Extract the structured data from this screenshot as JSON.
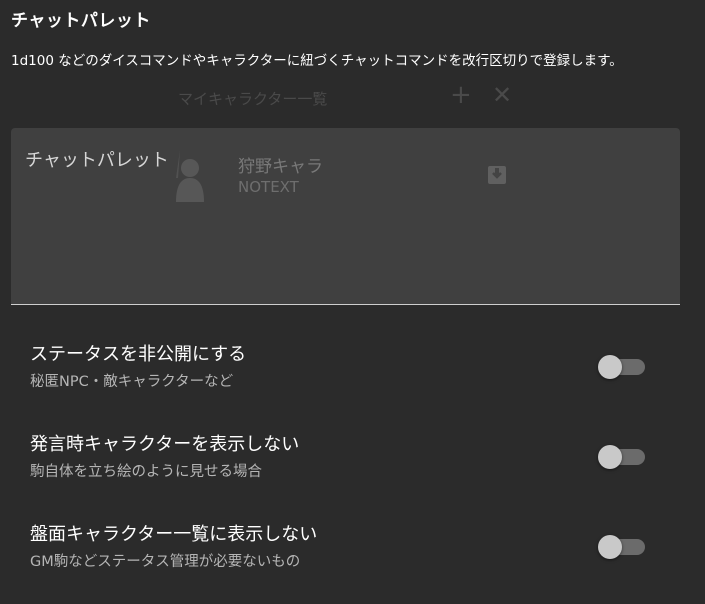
{
  "section": {
    "title": "チャットパレット",
    "description": "1d100 などのダイスコマンドやキャラクターに紐づくチャットコマンドを改行区切りで登録します。"
  },
  "background_window": {
    "title": "マイキャラクター一覧",
    "character_name": "狩野キャラ",
    "character_subtext": "NOTEXT",
    "plus_icon": "plus-icon",
    "close_icon": "close-icon",
    "save_icon": "save-icon",
    "avatar_icon": "character-silhouette"
  },
  "chat_palette": {
    "label": "チャットパレット",
    "value": ""
  },
  "settings": [
    {
      "title": "ステータスを非公開にする",
      "subtitle": "秘匿NPC・敵キャラクターなど",
      "enabled": false
    },
    {
      "title": "発言時キャラクターを表示しない",
      "subtitle": "駒自体を立ち絵のように見せる場合",
      "enabled": false
    },
    {
      "title": "盤面キャラクター一覧に表示しない",
      "subtitle": "GM駒などステータス管理が必要ないもの",
      "enabled": false
    }
  ],
  "colors": {
    "background": "#2b2b2b",
    "switch_track": "#6b6b6b",
    "switch_thumb": "#c9c9c9",
    "subtext": "#b5b5b5"
  }
}
